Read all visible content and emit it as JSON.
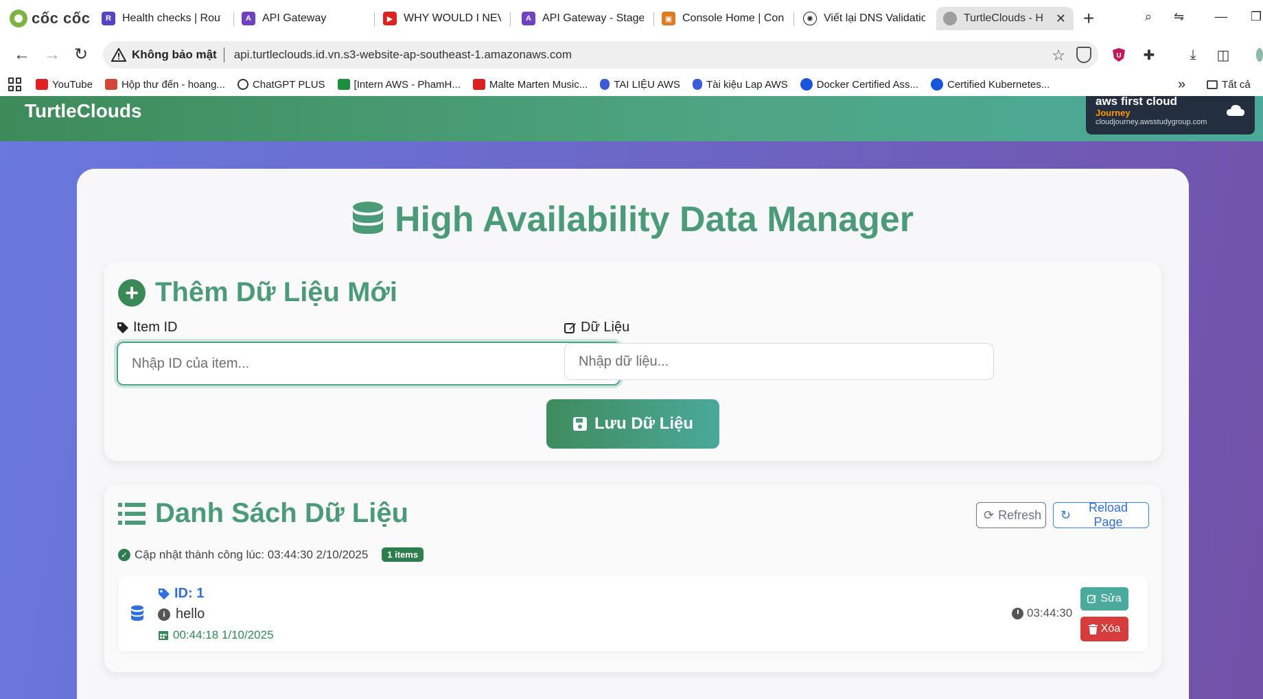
{
  "browser": {
    "brand": "cốc cốc",
    "tabs": [
      {
        "title": "Health checks | Route",
        "icon": "route53-icon",
        "color": "#5a43c2"
      },
      {
        "title": "API Gateway",
        "icon": "api-gateway-icon",
        "color": "#6f42c1"
      },
      {
        "title": "WHY WOULD I NEVE",
        "icon": "youtube-icon",
        "color": "#e02020"
      },
      {
        "title": "API Gateway - Stages",
        "icon": "api-gateway-icon",
        "color": "#6f42c1"
      },
      {
        "title": "Console Home | Cons",
        "icon": "aws-console-icon",
        "color": "#e07a1f"
      },
      {
        "title": "Viết lại DNS Validatio",
        "icon": "chatgpt-icon",
        "color": "#222222"
      },
      {
        "title": "TurtleClouds - H",
        "icon": "globe-icon",
        "color": "#888888",
        "active": true
      }
    ],
    "security_label": "Không bảo mật",
    "url": "api.turtleclouds.id.vn.s3-website-ap-southeast-1.amazonaws.com",
    "bookmarks": [
      {
        "label": "YouTube",
        "color": "#e02020"
      },
      {
        "label": "Hộp thư đến - hoang...",
        "color": "#d44638"
      },
      {
        "label": "ChatGPT PLUS",
        "color": "#333333"
      },
      {
        "label": "[Intern AWS - PhamH...",
        "color": "#1e8e3e"
      },
      {
        "label": "Malte Marten Music...",
        "color": "#e02020"
      },
      {
        "label": "TAI LIỆU AWS",
        "color": "#3b5bdb"
      },
      {
        "label": "Tài kiệu Lap AWS",
        "color": "#3b5bdb"
      },
      {
        "label": "Docker Certified Ass...",
        "color": "#1a56db"
      },
      {
        "label": "Certified Kubernetes...",
        "color": "#1a56db"
      }
    ],
    "all_bookmarks_label": "Tất cả"
  },
  "site": {
    "name": "TurtleClouds",
    "aws_badge": {
      "title": "aws first cloud",
      "subtitle": "Journey",
      "url": "cloudjourney.awsstudygroup.com"
    }
  },
  "page": {
    "title": "High Availability Data Manager"
  },
  "add_form": {
    "heading": "Thêm Dữ Liệu Mới",
    "item_id_label": "Item ID",
    "item_id_placeholder": "Nhập ID của item...",
    "item_id_value": "",
    "data_label": "Dữ Liệu",
    "data_placeholder": "Nhập dữ liệu...",
    "data_value": "",
    "save_label": "Lưu Dữ Liệu"
  },
  "list": {
    "heading": "Danh Sách Dữ Liệu",
    "refresh_label": "Refresh",
    "reload_label": "Reload Page",
    "status_text": "Cập nhật thành công lúc: 03:44:30 2/10/2025",
    "count_badge": "1 items",
    "items": [
      {
        "id_label": "ID: 1",
        "data": "hello",
        "created": "00:44:18 1/10/2025",
        "time": "03:44:30",
        "edit_label": "Sửa",
        "delete_label": "Xóa"
      }
    ]
  },
  "colors": {
    "brand_green": "#4b9b78",
    "header_gradient": [
      "#3e8b5a",
      "#4aa99a"
    ],
    "background_gradient": [
      "#6a79de",
      "#7251a8"
    ],
    "link_blue": "#2f6fe0",
    "danger": "#d63c3c",
    "teal": "#4aab9c"
  }
}
